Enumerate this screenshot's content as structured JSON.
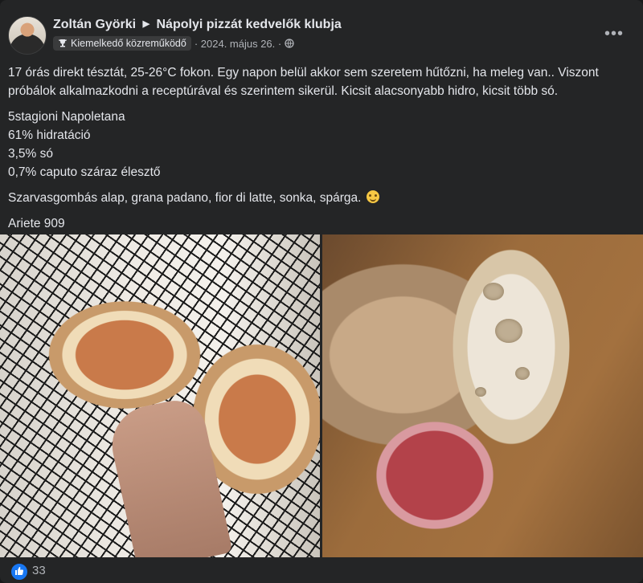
{
  "post": {
    "author": "Zoltán Györki",
    "group": "Nápolyi pizzát kedvelők klubja",
    "badge": "Kiemelkedő közreműködő",
    "date": "· 2024. május 26. ·",
    "more_label": "•••",
    "paragraph1": "17 órás direkt tésztát, 25-26°C fokon. Egy napon belül akkor sem szeretem hűtőzni, ha meleg van.. Viszont próbálok alkalmazkodni a receptúrával és szerintem sikerül. Kicsit alacsonyabb hidro, kicsit több só.",
    "recipe_lines": [
      "5stagioni Napoletana",
      "61% hidratáció",
      "3,5% só",
      "0,7% caputo száraz élesztő"
    ],
    "paragraph3": "Szarvasgombás alap, grana padano, fior di latte, sonka, spárga.",
    "paragraph4": "Ariete 909",
    "reaction_count": "33"
  },
  "icons": {
    "caret": "caret-right-icon",
    "badge": "trophy-icon",
    "privacy": "globe-icon",
    "more": "more-icon",
    "reaction": "like-icon",
    "emoji": "smiling-face-emoji"
  },
  "colors": {
    "background": "#242526",
    "text": "#e4e6eb",
    "secondary_text": "#b0b3b8",
    "like_blue": "#1877f2"
  }
}
